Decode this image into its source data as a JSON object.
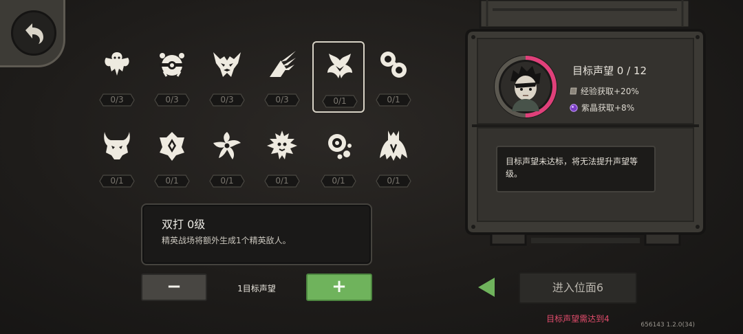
{
  "back_button": {
    "icon": "back-arrow-icon"
  },
  "mutators": [
    {
      "icon": "winged-beast-emblem-icon",
      "count": "0/3",
      "selected": false
    },
    {
      "icon": "bound-eye-emblem-icon",
      "count": "0/3",
      "selected": false
    },
    {
      "icon": "horned-skull-emblem-icon",
      "count": "0/3",
      "selected": false
    },
    {
      "icon": "claw-strike-emblem-icon",
      "count": "0/3",
      "selected": false
    },
    {
      "icon": "twin-flame-emblem-icon",
      "count": "0/1",
      "selected": true
    },
    {
      "icon": "swirl-orbs-emblem-icon",
      "count": "0/1",
      "selected": false
    },
    {
      "icon": "horned-demon-emblem-icon",
      "count": "0/1",
      "selected": false
    },
    {
      "icon": "crest-gem-emblem-icon",
      "count": "0/1",
      "selected": false
    },
    {
      "icon": "spiral-star-emblem-icon",
      "count": "0/1",
      "selected": false
    },
    {
      "icon": "spiked-bug-emblem-icon",
      "count": "0/1",
      "selected": false
    },
    {
      "icon": "eye-bubbles-emblem-icon",
      "count": "0/1",
      "selected": false
    },
    {
      "icon": "roots-emblem-icon",
      "count": "0/1",
      "selected": false
    }
  ],
  "detail": {
    "title": "双打 0级",
    "description": "精英战场将额外生成1个精英敌人。"
  },
  "controls": {
    "minus_label": "−",
    "plus_label": "+",
    "target_label": "1目标声望"
  },
  "reputation": {
    "title": "目标声望 0 / 12",
    "progress": 0.5,
    "buffs": [
      {
        "icon": "exp-crate-icon",
        "text": "经验获取+20%"
      },
      {
        "icon": "purple-crystal-icon",
        "text": "紫晶获取+8%"
      }
    ],
    "warning": "目标声望未达标，将无法提升声望等级。"
  },
  "enter": {
    "label": "进入位面6",
    "requirement": "目标声望需达到4"
  },
  "version": "656143 1.2.0(34)",
  "colors": {
    "accent_green": "#6fb35c",
    "ring_pink": "#e0407a",
    "warning_red": "#e24c6c"
  }
}
